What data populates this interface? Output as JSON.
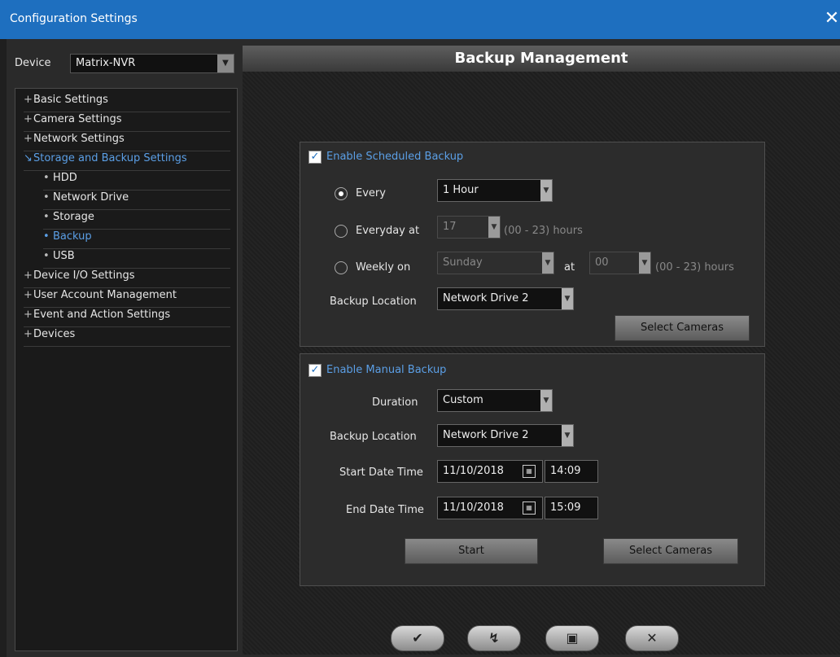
{
  "window": {
    "title": "Configuration Settings",
    "close_glyph": "✕"
  },
  "sidebar": {
    "device_label": "Device",
    "device_value": "Matrix-NVR",
    "tree": [
      {
        "label": "Basic Settings",
        "marker": "+"
      },
      {
        "label": "Camera Settings",
        "marker": "+"
      },
      {
        "label": "Network Settings",
        "marker": "+"
      },
      {
        "label": "Storage and Backup Settings",
        "marker": "↘"
      },
      {
        "label": "HDD",
        "marker": "•"
      },
      {
        "label": "Network Drive",
        "marker": "•"
      },
      {
        "label": "Storage",
        "marker": "•"
      },
      {
        "label": "Backup",
        "marker": "•"
      },
      {
        "label": "USB",
        "marker": "•"
      },
      {
        "label": "Device I/O Settings",
        "marker": "+"
      },
      {
        "label": "User Account Management",
        "marker": "+"
      },
      {
        "label": "Event and Action Settings",
        "marker": "+"
      },
      {
        "label": "Devices",
        "marker": "+"
      }
    ]
  },
  "main": {
    "header": "Backup Management",
    "scheduled": {
      "enable_label": "Enable Scheduled Backup",
      "enabled": true,
      "every_label": "Every",
      "every_value": "1 Hour",
      "everyday_label": "Everyday at",
      "everyday_value": "17",
      "everyday_hint": "(00 - 23) hours",
      "weekly_label": "Weekly on",
      "weekly_day": "Sunday",
      "weekly_at": "at",
      "weekly_hour": "00",
      "weekly_hint": "(00 - 23) hours",
      "location_label": "Backup Location",
      "location_value": "Network Drive 2",
      "select_cameras": "Select Cameras"
    },
    "manual": {
      "enable_label": "Enable Manual Backup",
      "enabled": true,
      "duration_label": "Duration",
      "duration_value": "Custom",
      "location_label": "Backup Location",
      "location_value": "Network Drive 2",
      "start_label": "Start Date Time",
      "start_date": "11/10/2018",
      "start_time": "14:09",
      "end_label": "End Date Time",
      "end_date": "11/10/2018",
      "end_time": "15:09",
      "start_button": "Start",
      "select_cameras": "Select Cameras"
    }
  },
  "footer": {
    "apply_glyph": "✔",
    "refresh_glyph": "↯",
    "save_glyph": "▣",
    "cancel_glyph": "✕"
  }
}
